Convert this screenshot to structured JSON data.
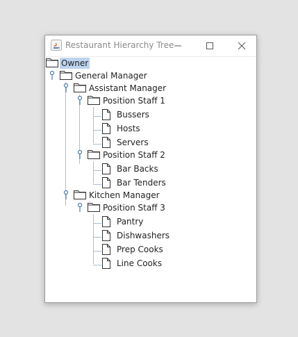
{
  "window": {
    "title": "Restaurant Hierarchy Tree"
  },
  "tree": {
    "root": "Owner",
    "general_manager": "General Manager",
    "assistant_manager": "Assistant Manager",
    "position_staff_1": "Position Staff 1",
    "bussers": "Bussers",
    "hosts": "Hosts",
    "servers": "Servers",
    "position_staff_2": "Position Staff 2",
    "bar_backs": "Bar Backs",
    "bar_tenders": "Bar Tenders",
    "kitchen_manager": "Kitchen Manager",
    "position_staff_3": "Position Staff 3",
    "pantry": "Pantry",
    "dishwashers": "Dishwashers",
    "prep_cooks": "Prep Cooks",
    "line_cooks": "Line Cooks"
  }
}
